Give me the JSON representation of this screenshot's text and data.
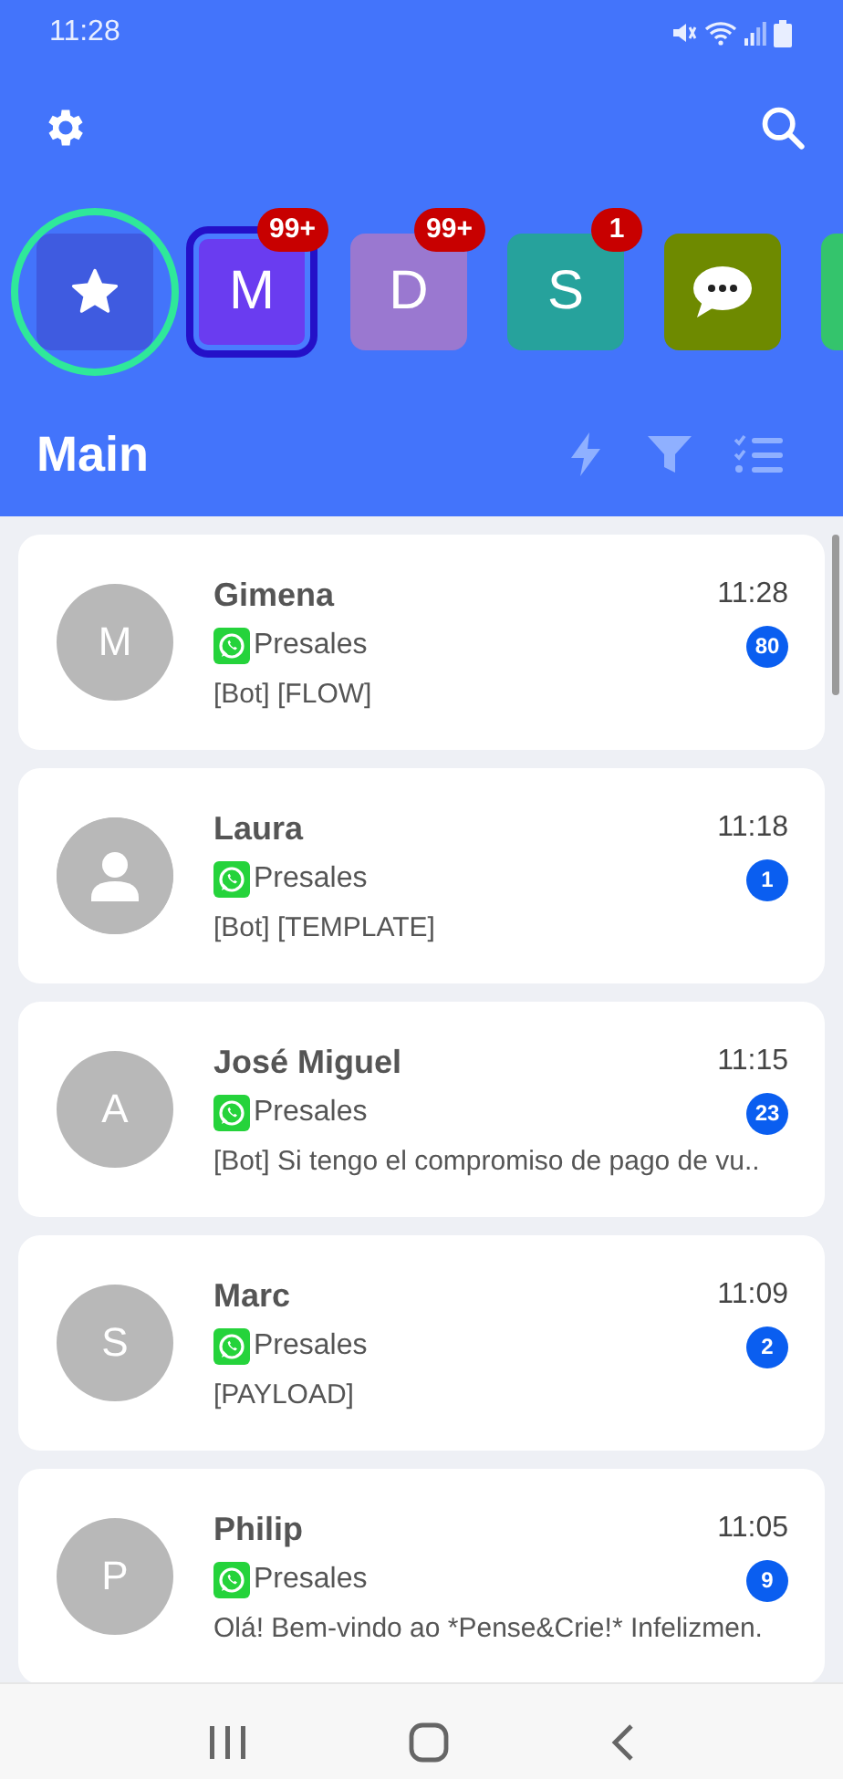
{
  "status_bar": {
    "time": "11:28"
  },
  "header": {
    "title": "Main"
  },
  "workspaces": [
    {
      "kind": "star",
      "color": "#3f5be0",
      "selected": false,
      "highlighted": true
    },
    {
      "kind": "letter",
      "label": "M",
      "badge": "99+",
      "color": "#6a3cf0",
      "selected": true,
      "highlighted": false
    },
    {
      "kind": "letter",
      "label": "D",
      "badge": "99+",
      "color": "#9a78d0",
      "selected": false,
      "highlighted": false
    },
    {
      "kind": "letter",
      "label": "S",
      "badge": "1",
      "color": "#26a29c",
      "selected": false,
      "highlighted": false
    },
    {
      "kind": "chat",
      "color": "#6e8a00",
      "selected": false,
      "highlighted": false
    },
    {
      "kind": "blank",
      "color": "#34c46c",
      "selected": false,
      "highlighted": false
    }
  ],
  "conversations": [
    {
      "name": "Gimena",
      "avatar": "M",
      "channel": "Presales",
      "preview": "[Bot] [FLOW]",
      "time": "11:28",
      "unread": "80"
    },
    {
      "name": "Laura",
      "channel": "Presales",
      "preview": "[Bot] [TEMPLATE]",
      "time": "11:18",
      "unread": "1"
    },
    {
      "name": "José Miguel",
      "avatar": "A",
      "channel": "Presales",
      "preview": "[Bot] Si tengo el compromiso de pago de vu..",
      "time": "11:15",
      "unread": "23"
    },
    {
      "name": "Marc",
      "avatar": "S",
      "channel": "Presales",
      "preview": "[PAYLOAD]",
      "time": "11:09",
      "unread": "2"
    },
    {
      "name": "Philip",
      "avatar": "P",
      "channel": "Presales",
      "preview": "Olá! Bem-vindo ao *Pense&Crie!* Infelizmen.",
      "time": "11:05",
      "unread": "9"
    }
  ]
}
